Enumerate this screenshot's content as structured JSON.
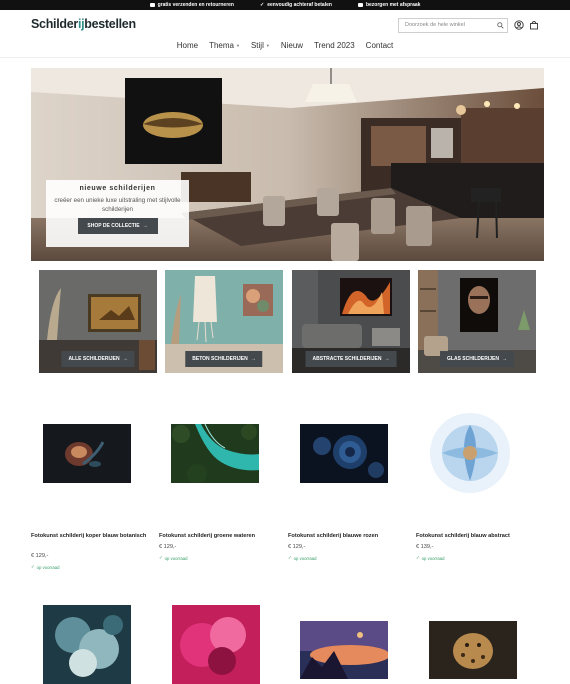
{
  "topbar": {
    "usps": [
      {
        "icon": "truck-icon",
        "label": "gratis verzenden en retourneren"
      },
      {
        "icon": "check-icon",
        "label": "eenvoudig achteraf betalen"
      },
      {
        "icon": "box-icon",
        "label": "bezorgen met afspraak"
      }
    ]
  },
  "header": {
    "logo": {
      "part1": "Schilder",
      "part2": "ij",
      "part3": "bestellen"
    },
    "search_placeholder": "Doorzoek de hele winkel",
    "nav": [
      {
        "label": "Home",
        "dropdown": false
      },
      {
        "label": "Thema",
        "dropdown": true
      },
      {
        "label": "Stijl",
        "dropdown": true
      },
      {
        "label": "Nieuw",
        "dropdown": false
      },
      {
        "label": "Trend 2023",
        "dropdown": false
      },
      {
        "label": "Contact",
        "dropdown": false
      }
    ]
  },
  "hero": {
    "title": "nieuwe schilderijen",
    "subtitle": "creëer een unieke luxe uitstraling met stijlvolle schilderijen",
    "button": "SHOP DE COLLECTIE"
  },
  "categories": [
    {
      "button": "ALLE SCHILDERIJEN"
    },
    {
      "button": "BETON SCHILDERIJEN"
    },
    {
      "button": "ABSTRACTE SCHILDERIJEN"
    },
    {
      "button": "GLAS SCHILDERIJEN"
    }
  ],
  "products": [
    {
      "name": "Fotokunst schilderij koper blauw botanisch",
      "price": "€ 129,-",
      "stock": "op voorraad"
    },
    {
      "name": "Fotokunst schilderij groene wateren",
      "price": "€ 129,-",
      "stock": "op voorraad"
    },
    {
      "name": "Fotokunst schilderij blauwe rozen",
      "price": "€ 129,-",
      "stock": "op voorraad"
    },
    {
      "name": "Fotokunst schilderij blauw abstract",
      "price": "€ 139,-",
      "stock": "op voorraad"
    }
  ],
  "colors": {
    "accent": "#2f8d8b",
    "button": "#44494d",
    "stock": "#3a9e6a"
  }
}
